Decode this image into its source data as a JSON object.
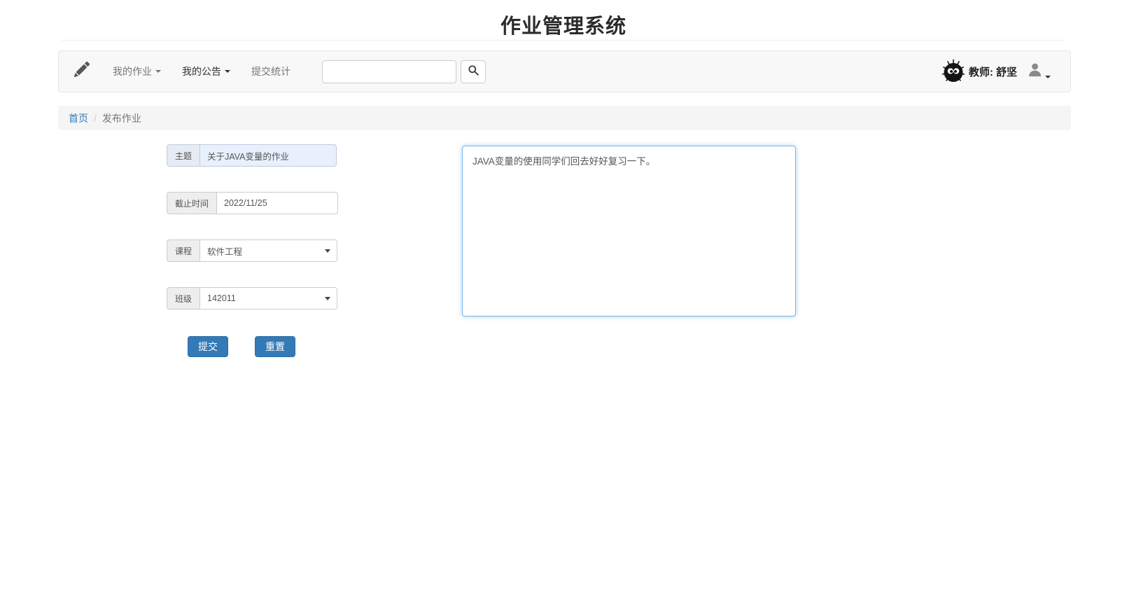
{
  "page": {
    "title": "作业管理系统"
  },
  "navbar": {
    "items": [
      {
        "label": "我的作业",
        "has_caret": true
      },
      {
        "label": "我的公告",
        "has_caret": true,
        "active": true
      },
      {
        "label": "提交统计",
        "has_caret": false
      }
    ],
    "search": {
      "value": "",
      "placeholder": ""
    },
    "user": {
      "name": "教师: 舒坚"
    }
  },
  "breadcrumb": {
    "items": [
      "首页",
      "发布作业"
    ],
    "separator": "/"
  },
  "form": {
    "subject": {
      "label": "主题",
      "value": "关于JAVA变量的作业"
    },
    "deadline": {
      "label": "截止时间",
      "value": "2022/11/25"
    },
    "course": {
      "label": "课程",
      "value": "软件工程"
    },
    "clazz": {
      "label": "班级",
      "value": "142011"
    },
    "content": {
      "value": "JAVA变量的使用同学们回去好好复习一下。"
    },
    "submit_label": "提交",
    "reset_label": "重置"
  },
  "icons": {
    "brand": "pencil",
    "search": "magnifier",
    "account": "person-silhouette",
    "avatar": "soot-sprite",
    "caret": "triangle-down"
  },
  "colors": {
    "primary_button": "#337ab7",
    "link": "#337ab7",
    "navbar_bg": "#f8f8f8",
    "breadcrumb_bg": "#f5f5f5",
    "autofill_bg": "#e8f0fe",
    "focus_border": "#7db6e2"
  }
}
